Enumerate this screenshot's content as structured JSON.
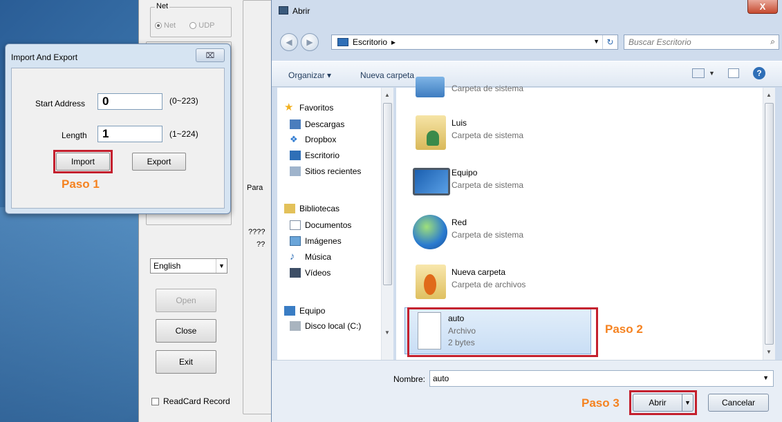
{
  "bg_app": {
    "net_group": "Net",
    "radio_net": "Net",
    "radio_udp": "UDP",
    "param_group_label": "Para",
    "unknown_label_1": "????",
    "unknown_label_2": "??",
    "language": "English",
    "open_label": "Open",
    "close_label": "Close",
    "exit_label": "Exit",
    "readcard_label": "ReadCard Record"
  },
  "import_export": {
    "title": "Import And Export",
    "close_glyph": "⌧",
    "start_address_label": "Start Address",
    "start_address_value": "0",
    "start_address_range": "(0~223)",
    "length_label": "Length",
    "length_value": "1",
    "length_range": "(1~224)",
    "import_label": "Import",
    "export_label": "Export",
    "step1": "Paso 1"
  },
  "abrir": {
    "title": "Abrir",
    "close_glyph": "X",
    "address": "Escritorio",
    "address_sep": "▸",
    "search_placeholder": "Buscar Escritorio",
    "toolbar": {
      "organize": "Organizar ▾",
      "new_folder": "Nueva carpeta"
    },
    "nav": [
      {
        "label": "Favoritos",
        "icon": "star-icon"
      },
      {
        "label": "Descargas",
        "icon": "downloads-icon"
      },
      {
        "label": "Dropbox",
        "icon": "dropbox-icon"
      },
      {
        "label": "Escritorio",
        "icon": "desktop-icon"
      },
      {
        "label": "Sitios recientes",
        "icon": "recent-icon"
      },
      {
        "label": "Bibliotecas",
        "icon": "library-icon"
      },
      {
        "label": "Documentos",
        "icon": "documents-icon"
      },
      {
        "label": "Imágenes",
        "icon": "images-icon"
      },
      {
        "label": "Música",
        "icon": "music-icon"
      },
      {
        "label": "Vídeos",
        "icon": "videos-icon"
      },
      {
        "label": "Equipo",
        "icon": "computer-icon"
      },
      {
        "label": "Disco local (C:)",
        "icon": "disk-icon"
      }
    ],
    "files": [
      {
        "name": "",
        "type": "Carpeta de sistema"
      },
      {
        "name": "Luis",
        "type": "Carpeta de sistema"
      },
      {
        "name": "Equipo",
        "type": "Carpeta de sistema"
      },
      {
        "name": "Red",
        "type": "Carpeta de sistema"
      },
      {
        "name": "Nueva carpeta",
        "type": "Carpeta de archivos"
      },
      {
        "name": "auto",
        "type": "Archivo",
        "size": "2 bytes"
      }
    ],
    "step2": "Paso 2",
    "filename_label": "Nombre:",
    "filename_value": "auto",
    "open_button": "Abrir",
    "cancel_button": "Cancelar",
    "step3": "Paso 3"
  },
  "colors": {
    "accent_red": "#c4202e",
    "step_orange": "#f58220"
  }
}
